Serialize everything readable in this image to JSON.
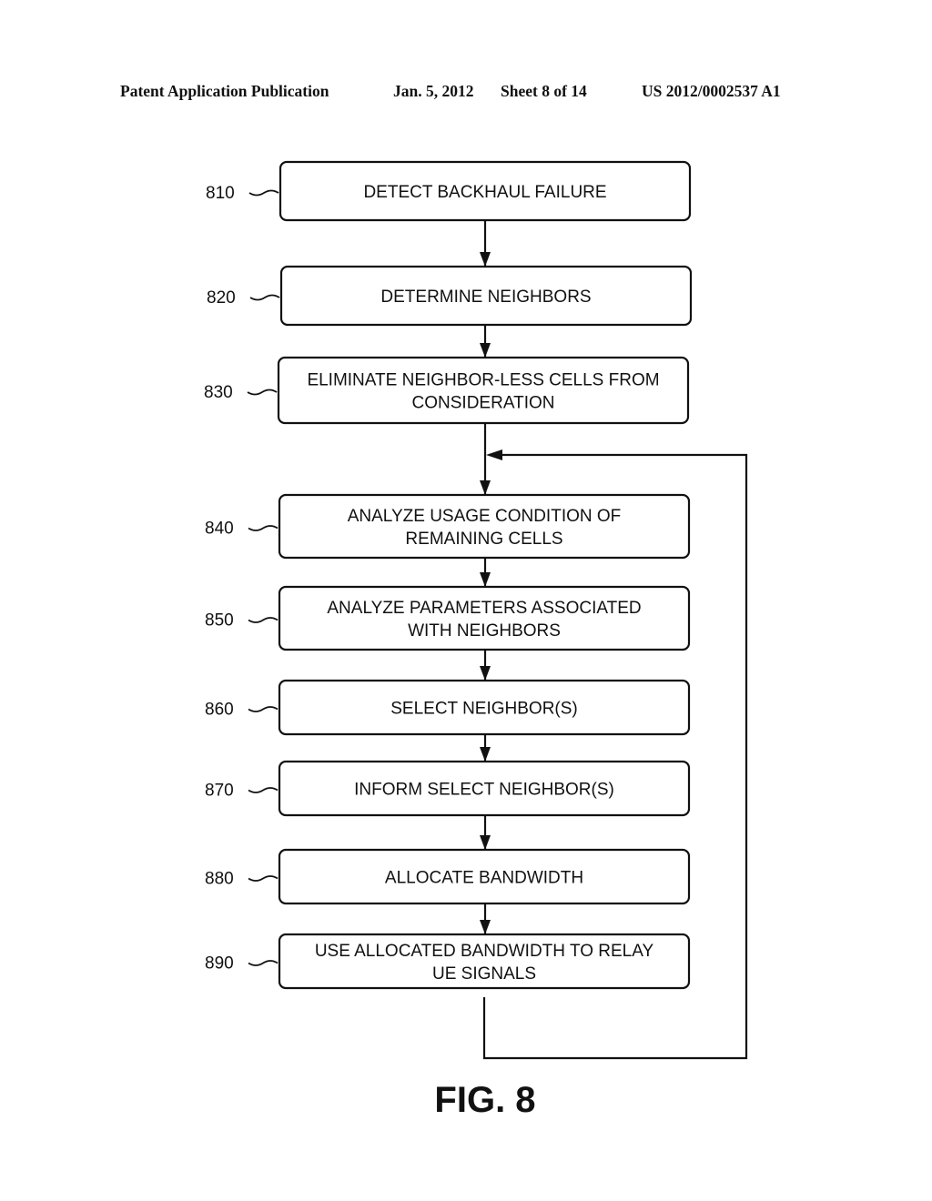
{
  "header": {
    "publication_type": "Patent Application Publication",
    "date": "Jan. 5, 2012",
    "sheet": "Sheet 8 of 14",
    "publication_number": "US 2012/0002537 A1"
  },
  "flowchart": {
    "steps": [
      {
        "ref": "810",
        "lines": [
          "DETECT BACKHAUL FAILURE"
        ]
      },
      {
        "ref": "820",
        "lines": [
          "DETERMINE NEIGHBORS"
        ]
      },
      {
        "ref": "830",
        "lines": [
          "ELIMINATE NEIGHBOR-LESS CELLS FROM",
          "CONSIDERATION"
        ]
      },
      {
        "ref": "840",
        "lines": [
          "ANALYZE USAGE CONDITION OF",
          "REMAINING CELLS"
        ]
      },
      {
        "ref": "850",
        "lines": [
          "ANALYZE PARAMETERS ASSOCIATED",
          "WITH NEIGHBORS"
        ]
      },
      {
        "ref": "860",
        "lines": [
          "SELECT NEIGHBOR(S)"
        ]
      },
      {
        "ref": "870",
        "lines": [
          "INFORM SELECT NEIGHBOR(S)"
        ]
      },
      {
        "ref": "880",
        "lines": [
          "ALLOCATE BANDWIDTH"
        ]
      },
      {
        "ref": "890",
        "lines": [
          "USE ALLOCATED BANDWIDTH TO RELAY",
          "UE SIGNALS"
        ]
      }
    ],
    "loop": {
      "from": "890",
      "to": "840"
    }
  },
  "figure_label": "FIG. 8"
}
